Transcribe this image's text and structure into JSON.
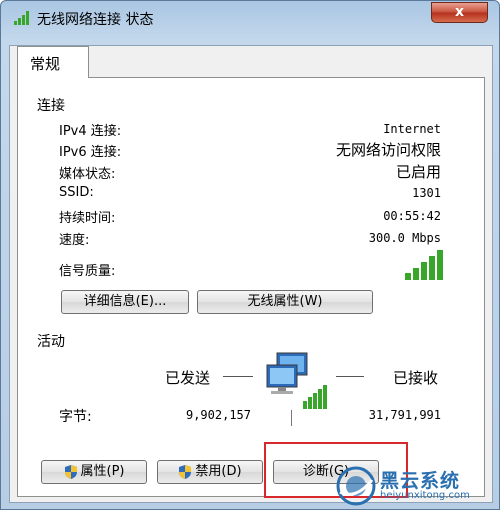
{
  "window": {
    "title": "无线网络连接 状态",
    "close_glyph": "x"
  },
  "tabs": [
    {
      "label": "常规"
    }
  ],
  "connection": {
    "section_title": "连接",
    "rows": [
      {
        "label": "IPv4 连接:",
        "value": "Internet"
      },
      {
        "label": "IPv6 连接:",
        "value": "无网络访问权限"
      },
      {
        "label": "媒体状态:",
        "value": "已启用"
      },
      {
        "label": "SSID:",
        "value": "1301"
      },
      {
        "label": "持续时间:",
        "value": "00:55:42"
      },
      {
        "label": "速度:",
        "value": "300.0 Mbps"
      }
    ],
    "signal_label": "信号质量:",
    "signal_bars": 5,
    "buttons": {
      "details": "详细信息(E)...",
      "wireless_properties": "无线属性(W)"
    }
  },
  "activity": {
    "section_title": "活动",
    "sent_label": "已发送",
    "received_label": "已接收",
    "bytes_label": "字节:",
    "bytes_sent": "9,902,157",
    "bytes_received": "31,791,991"
  },
  "footer_buttons": {
    "properties": "属性(P)",
    "disable": "禁用(D)",
    "diagnose": "诊断(G)"
  },
  "watermark": {
    "name": "黑云系统",
    "url": "heiyunxitong.com"
  },
  "colors": {
    "signal_green": "#3aa52b",
    "highlight_red": "#d8282b",
    "watermark_blue": "#2a6fb0"
  }
}
